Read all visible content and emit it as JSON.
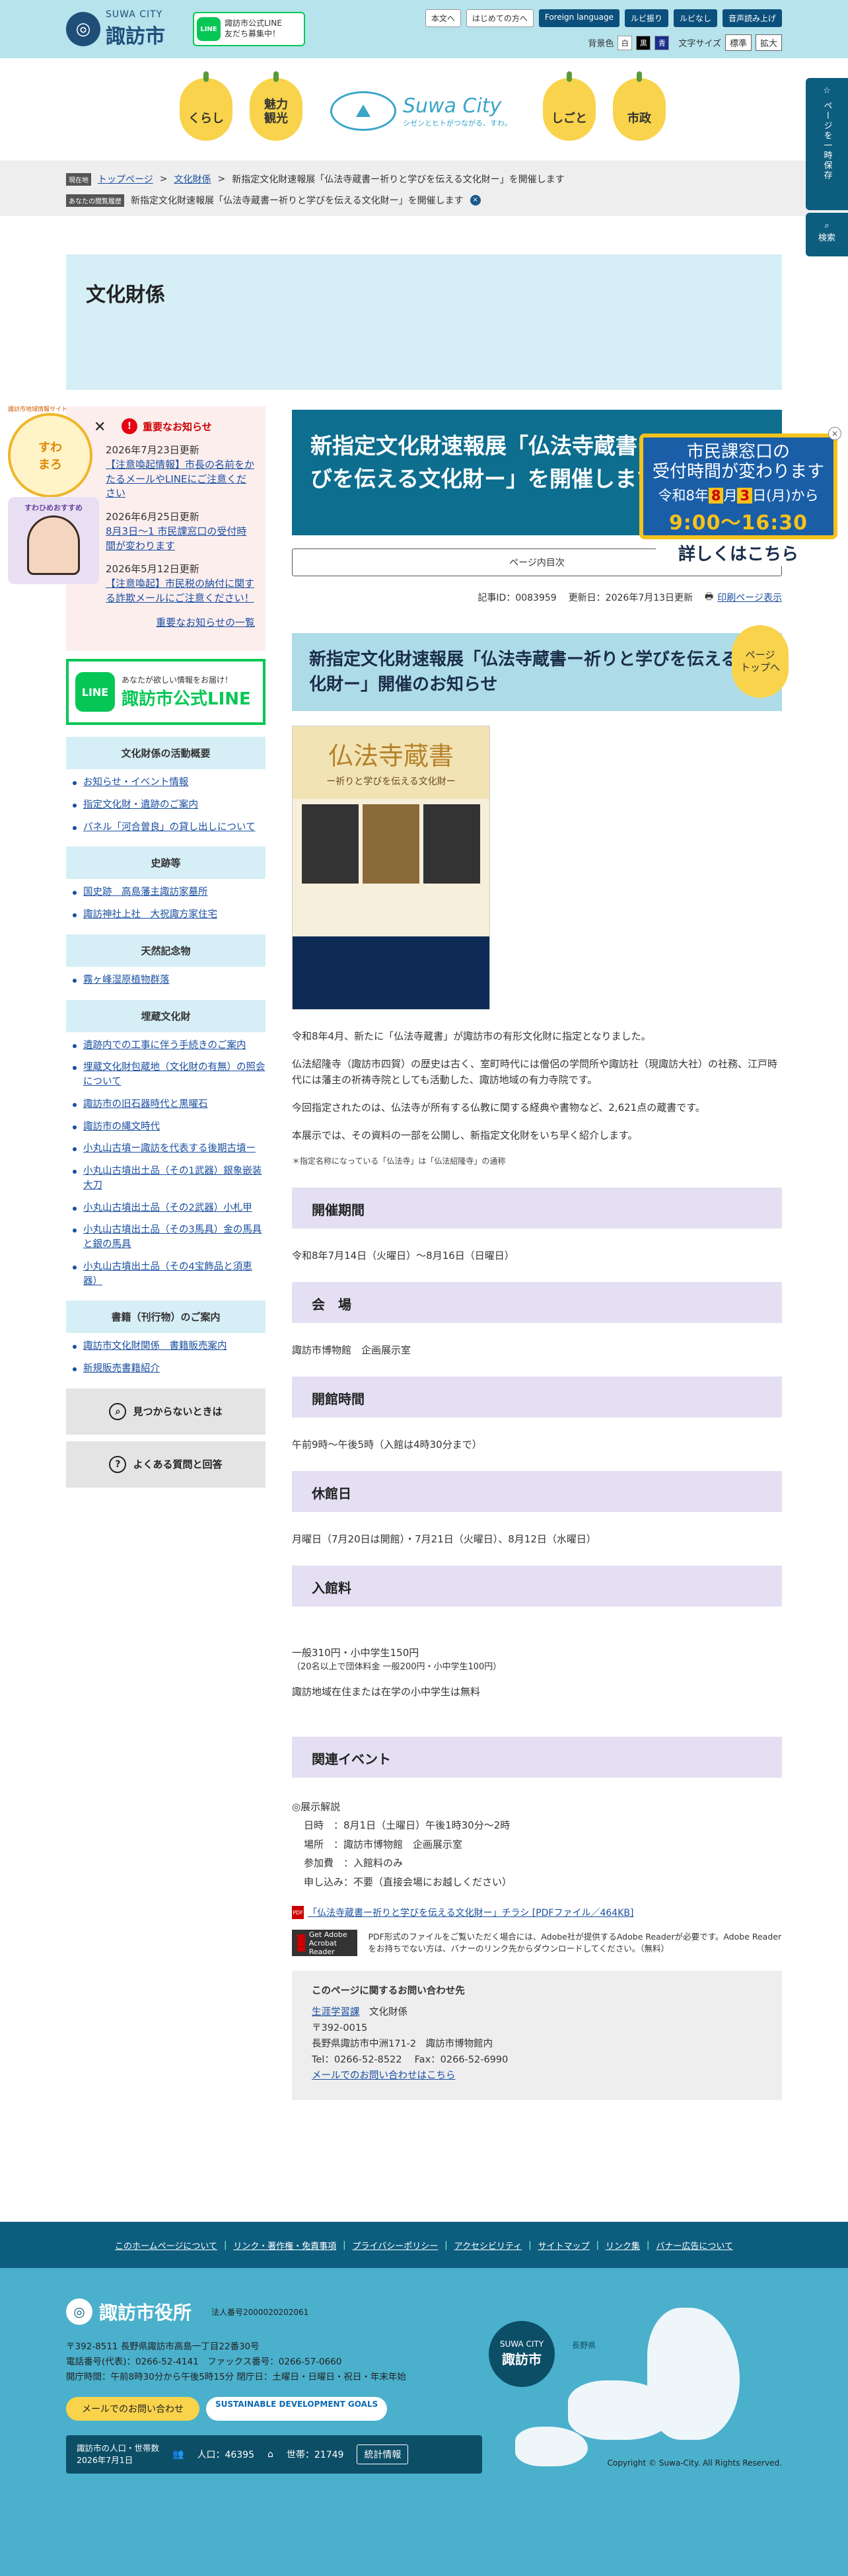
{
  "header": {
    "logo_small": "SUWA CITY",
    "logo_big": "諏訪市",
    "line_badge": "諏訪市公式LINE\n友だち募集中！",
    "buttons": [
      "本文へ",
      "はじめての方へ",
      "Foreign language",
      "ルビ振り",
      "ルビなし",
      "音声読み上げ"
    ],
    "bg_label": "背景色",
    "bg_swatches": [
      "白",
      "黒",
      "青"
    ],
    "font_label": "文字サイズ",
    "font_buttons": [
      "標準",
      "拡大"
    ]
  },
  "nav": {
    "items": [
      "くらし",
      "魅力\n観光",
      "しごと",
      "市政"
    ],
    "center_title": "Suwa City",
    "center_sub": "シゼンとヒトがつながる、すわ。"
  },
  "breadcrumb": {
    "tag1": "現在地",
    "tag2": "あなたの閲覧履歴",
    "crumbs": [
      "トップページ",
      "文化財係"
    ],
    "current": "新指定文化財速報展「仏法寺蔵書ー祈りと学びを伝える文化財ー」を開催します",
    "history": "新指定文化財速報展「仏法寺蔵書ー祈りと学びを伝える文化財ー」を開催します"
  },
  "side_tabs": {
    "save": "ページを一時保存",
    "search": "検索"
  },
  "category": {
    "title": "文化財係"
  },
  "notice": {
    "title": "重要なお知らせ",
    "items": [
      {
        "date": "2026年7月23日更新",
        "text": "【注意喚起情報】市長の名前をかたるメールやLINEにご注意ください"
      },
      {
        "date": "2026年6月25日更新",
        "text": "8月3日〜1 市民課窓口の受付時間が変わります"
      },
      {
        "date": "2026年5月12日更新",
        "text": "【注意喚起】市民税の納付に関する詐欺メールにご注意ください！"
      }
    ],
    "more": "重要なお知らせの一覧"
  },
  "line_banner": {
    "sub": "あなたが欲しい情報をお届け！",
    "main": "諏訪市公式LINE"
  },
  "sidebar_sections": [
    {
      "title": "文化財係の活動概要",
      "links": [
        "お知らせ・イベント情報",
        "指定文化財・遺跡のご案内",
        "パネル「河合曽良」の貸し出しについて"
      ]
    },
    {
      "title": "史跡等",
      "links": [
        "国史跡　高島藩主諏訪家墓所",
        "諏訪神社上社　大祝諏方家住宅"
      ]
    },
    {
      "title": "天然記念物",
      "links": [
        "霧ヶ峰湿原植物群落"
      ]
    },
    {
      "title": "埋蔵文化財",
      "links": [
        "遺跡内での工事に伴う手続きのご案内",
        "埋蔵文化財包蔵地（文化財の有無）の照会について",
        "諏訪市の旧石器時代と黒曜石",
        "諏訪市の縄文時代",
        "小丸山古墳ー諏訪を代表する後期古墳ー",
        "小丸山古墳出土品（その1武器）銀象嵌装大刀",
        "小丸山古墳出土品（その2武器）小札甲",
        "小丸山古墳出土品（その3馬具）金の馬具と銀の馬具",
        "小丸山古墳出土品（その4宝飾品と須恵器）"
      ]
    },
    {
      "title": "書籍（刊行物）のご案内",
      "links": [
        "諏訪市文化財関係　書籍販売案内",
        "新規販売書籍紹介"
      ]
    }
  ],
  "gray_buttons": [
    {
      "label": "見つからないときは",
      "icon": "search-icon"
    },
    {
      "label": "よくある質問と回答",
      "icon": "question-icon"
    }
  ],
  "mascot": {
    "header": "諏訪市地域情報サイト",
    "circle": "すわ\nまろ",
    "title": "すわひめおすすめ"
  },
  "popup": {
    "line1": "市民課窓口の",
    "line2": "受付時間が変わります",
    "date_pre": "令和8年",
    "month": "8",
    "month_unit": "月",
    "day": "3",
    "day_unit": "日",
    "weekday": "(月)から",
    "time": "9:00〜16:30",
    "button": "詳しくはこちら"
  },
  "main": {
    "title": "新指定文化財速報展「仏法寺蔵書ー祈りと学びを伝える文化財ー」を開催します",
    "toc": "ページ内目次",
    "record_id": "記事ID：0083959",
    "updated": "更新日：2026年7月13日更新",
    "print": "印刷ページ表示",
    "heading": "新指定文化財速報展「仏法寺蔵書ー祈りと学びを伝える文化財ー」開催のお知らせ",
    "poster_title": "仏法寺蔵書",
    "poster_sub": "ー祈りと学びを伝える文化財ー",
    "paragraphs": [
      "令和8年4月、新たに「仏法寺蔵書」が諏訪市の有形文化財に指定となりました。",
      "仏法紹隆寺（諏訪市四賀）の歴史は古く、室町時代には僧侶の学問所や諏訪社（現諏訪大社）の社務、江戸時代には藩主の祈祷寺院としても活動した、諏訪地域の有力寺院です。",
      "今回指定されたのは、仏法寺が所有する仏教に関する経典や書物など、2,621点の蔵書です。",
      "本展示では、その資料の一部を公開し、新指定文化財をいち早く紹介します。"
    ],
    "note": "＊指定名称になっている「仏法寺」は「仏法紹隆寺」の通称",
    "sections": [
      {
        "heading": "開催期間",
        "value": "令和8年7月14日（火曜日）〜8月16日（日曜日）"
      },
      {
        "heading": "会　場",
        "value": "諏訪市博物館　企画展示室"
      },
      {
        "heading": "開館時間",
        "value": "午前9時〜午後5時（入館は4時30分まで）"
      },
      {
        "heading": "休館日",
        "value": "月曜日（7月20日は開館）・7月21日（火曜日）、8月12日（水曜日）"
      }
    ],
    "fee_heading": "入館料",
    "fee_line1": "一般310円・小中学生150円",
    "fee_line2": "（20名以上で団体料金 一般200円・小中学生100円）",
    "fee_line3": "諏訪地域在住または在学の小中学生は無料",
    "event_heading": "関連イベント",
    "event_title": "◎展示解説",
    "event_lines": [
      "日時　：8月1日（土曜日）午後1時30分〜2時",
      "場所　：諏訪市博物館　企画展示室",
      "参加費　：入館料のみ",
      "申し込み：不要（直接会場にお越しください）"
    ],
    "pdf_link": "「仏法寺蔵書ー祈りと学びを伝える文化財ー」チラシ [PDFファイル／464KB]",
    "adobe_badge": "Get Adobe Acrobat Reader",
    "adobe_text": "PDF形式のファイルをご覧いただく場合には、Adobe社が提供するAdobe Readerが必要です。Adobe Readerをお持ちでない方は、バナーのリンク先からダウンロードしてください。（無料）",
    "contact": {
      "title": "このページに関するお問い合わせ先",
      "dept_link": "生涯学習課",
      "dept_sub": "文化財係",
      "zip": "〒392-0015",
      "address": "長野県諏訪市中洲171-2　諏訪市博物館内",
      "tel": "Tel：0266-52-8522　 Fax：0266-52-6990",
      "mail": "メールでのお問い合わせはこちら"
    }
  },
  "pagetop": "ページ\nトップへ",
  "footer_nav": [
    "このホームページについて",
    "リンク・著作権・免責事項",
    "プライバシーポリシー",
    "アクセシビリティ",
    "サイトマップ",
    "リンク集",
    "バナー広告について"
  ],
  "footer": {
    "org": "諏訪市役所",
    "corp_no": "法人番号2000020202061",
    "address": "〒392-8511 長野県諏訪市高島一丁目22番30号",
    "phone": "電話番号(代表)：0266-52-4141　ファックス番号：0266-57-0660",
    "hours": "開庁時間：午前8時30分から午後5時15分 閉庁日：土曜日・日曜日・祝日・年末年始",
    "mail_btn": "メールでのお問い合わせ",
    "sdgs": "SUSTAINABLE DEVELOPMENT GOALS",
    "stats_label": "諏訪市の人口・世帯数",
    "stats_date": "2026年7月1日",
    "population": "人口：46395",
    "households": "世帯：21749",
    "stats_btn": "統計情報",
    "map_label_small": "SUWA CITY",
    "map_label_big": "諏訪市",
    "map_pref": "長野県",
    "copyright": "Copyright © Suwa-City. All Rights Reserved."
  }
}
